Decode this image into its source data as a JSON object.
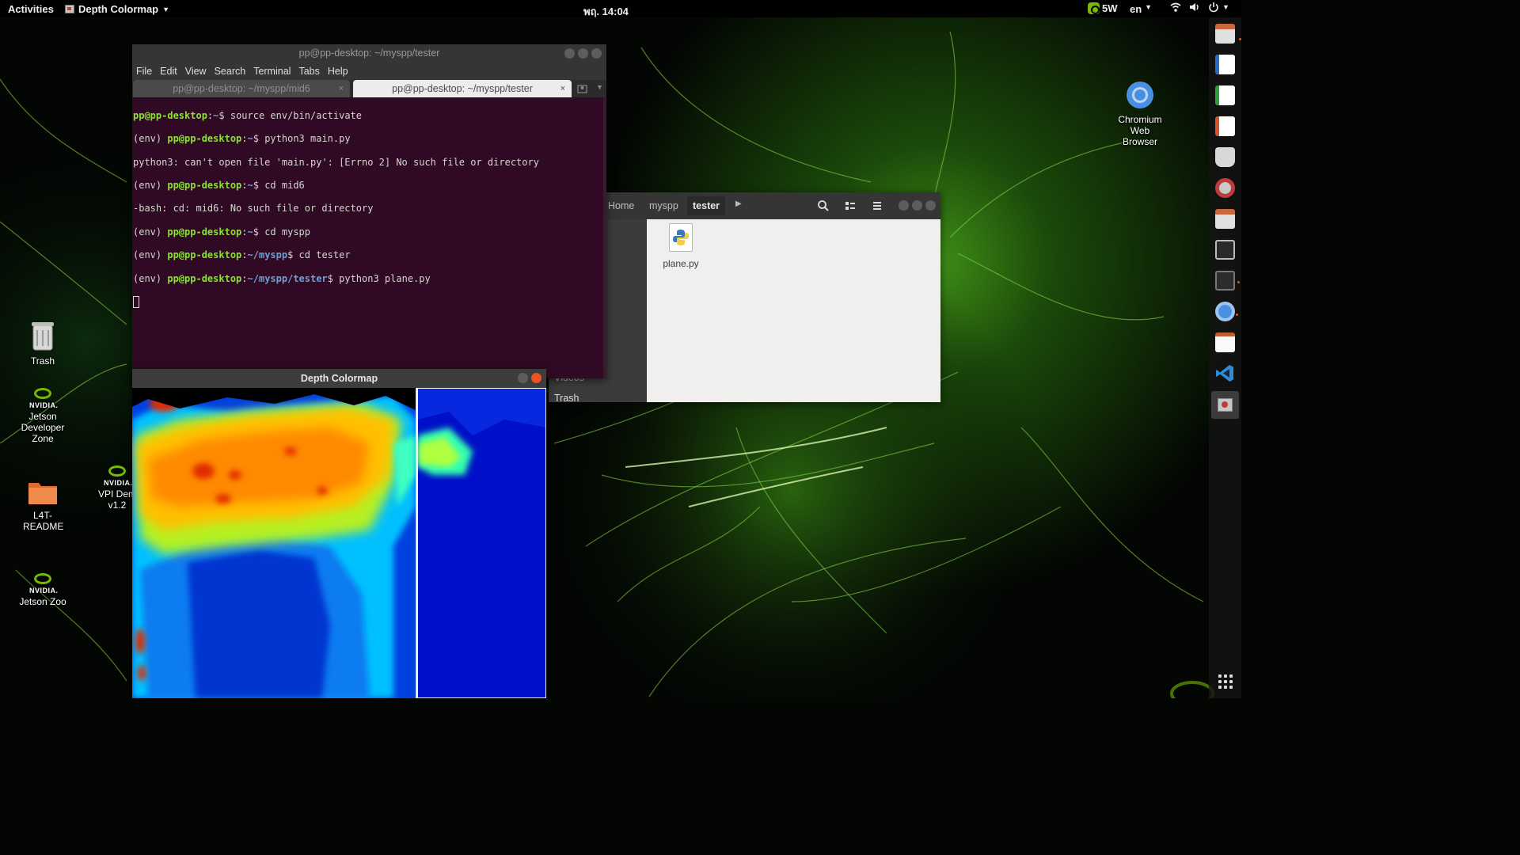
{
  "topbar": {
    "activities": "Activities",
    "app_name": "Depth Colormap",
    "clock": "พฤ. 14:04",
    "nvidia_power": "5W",
    "input_lang": "en"
  },
  "dock": {
    "icons": [
      "files-icon",
      "writer-icon",
      "calc-icon",
      "impress-icon",
      "software-icon",
      "settings-icon",
      "files2-icon",
      "monitor-icon",
      "terminal-icon",
      "chromium-icon",
      "text-editor-icon",
      "vscode-icon",
      "depth-colormap-icon"
    ]
  },
  "desktop": {
    "chromium": "Chromium Web Browser",
    "trash": "Trash",
    "jetson_dev_zone": "Jetson Developer Zone",
    "vpi_demos": "VPI Dem v1.2",
    "l4t_readme": "L4T-README",
    "jetson_zoo": "Jetson Zoo",
    "nvidia_wordmark": "NVIDIA."
  },
  "terminal": {
    "title": "pp@pp-desktop: ~/myspp/tester",
    "menu": [
      "File",
      "Edit",
      "View",
      "Search",
      "Terminal",
      "Tabs",
      "Help"
    ],
    "tabs": [
      {
        "label": "pp@pp-desktop: ~/myspp/mid6",
        "close": "×"
      },
      {
        "label": "pp@pp-desktop: ~/myspp/tester",
        "close": "×"
      }
    ],
    "lines": [
      {
        "env": "",
        "user": "pp@pp-desktop",
        "sep": ":",
        "path": "~",
        "cmd": "$ source env/bin/activate"
      },
      {
        "env": "(env) ",
        "user": "pp@pp-desktop",
        "sep": ":",
        "path": "~",
        "cmd": "$ python3 main.py"
      },
      {
        "plain": "python3: can't open file 'main.py': [Errno 2] No such file or directory"
      },
      {
        "env": "(env) ",
        "user": "pp@pp-desktop",
        "sep": ":",
        "path": "~",
        "cmd": "$ cd mid6"
      },
      {
        "plain": "-bash: cd: mid6: No such file or directory"
      },
      {
        "env": "(env) ",
        "user": "pp@pp-desktop",
        "sep": ":",
        "path": "~",
        "cmd": "$ cd myspp"
      },
      {
        "env": "(env) ",
        "user": "pp@pp-desktop",
        "sep": ":",
        "path": "~/myspp",
        "cmd": "$ cd tester"
      },
      {
        "env": "(env) ",
        "user": "pp@pp-desktop",
        "sep": ":",
        "path": "~/myspp/tester",
        "cmd": "$ python3 plane.py"
      }
    ]
  },
  "files": {
    "breadcrumbs": [
      "Home",
      "myspp",
      "tester"
    ],
    "sidebar": {
      "videos": "Videos",
      "trash": "Trash"
    },
    "items": [
      {
        "name": "plane.py",
        "icon": "python-file-icon"
      }
    ]
  },
  "depth_window": {
    "title": "Depth Colormap"
  },
  "colors": {
    "terminal_bg": "#300a24",
    "prompt_green": "#8ae234",
    "prompt_blue": "#729fcf",
    "nvidia_green": "#76b900",
    "ubuntu_orange": "#e95420"
  }
}
